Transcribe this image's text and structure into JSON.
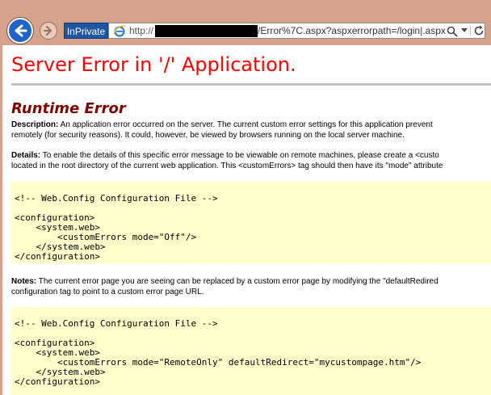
{
  "browser": {
    "inprivate_label": "InPrivate",
    "url_prefix": "http://",
    "url_suffix": "/Error%7C.aspx?aspxerrorpath=/login|.aspx"
  },
  "page": {
    "title": "Server Error in '/' Application.",
    "runtime_title": "Runtime Error",
    "description": {
      "label": "Description:",
      "line1": " An application error occurred on the server. The current custom error settings for this application prevent",
      "line2": "remotely (for security reasons). It could, however, be viewed by browsers running on the local server machine."
    },
    "details": {
      "label": "Details:",
      "line1": " To enable the details of this specific error message to be viewable on remote machines, please create a <custo",
      "line2": "located in the root directory of the current web application. This <customErrors> tag should then have its \"mode\" attribute"
    },
    "code1": "\n<!-- Web.Config Configuration File -->\n\n<configuration>\n    <system.web>\n        <customErrors mode=\"Off\"/>\n    </system.web>\n</configuration>",
    "notes": {
      "label": "Notes:",
      "line1": " The current error page you are seeing can be replaced by a custom error page by modifying the \"defaultRedired",
      "line2": "configuration tag to point to a custom error page URL."
    },
    "code2": "\n<!-- Web.Config Configuration File -->\n\n<configuration>\n    <system.web>\n        <customErrors mode=\"RemoteOnly\" defaultRedirect=\"mycustompage.htm\"/>\n    </system.web>\n</configuration>"
  },
  "colors": {
    "chrome": "#d5a28c",
    "title_red": "#ff0000",
    "runtime_maroon": "#800000",
    "code_bg": "#ffffcc"
  },
  "icons": [
    "back-arrow-icon",
    "forward-arrow-icon",
    "ie-logo-icon",
    "search-icon",
    "chevron-down-icon",
    "refresh-icon"
  ]
}
